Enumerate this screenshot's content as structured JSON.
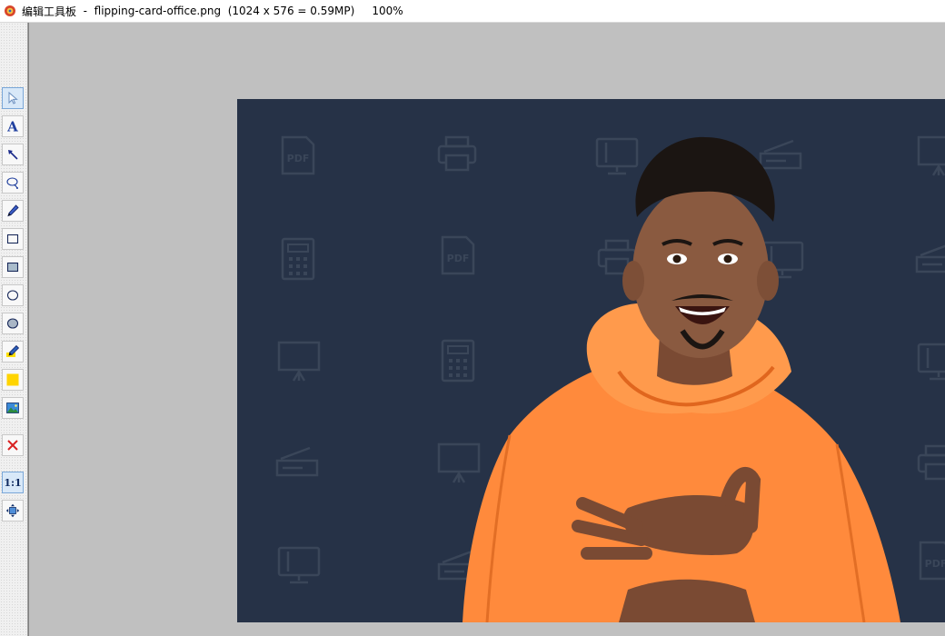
{
  "window": {
    "app_name": "编辑工具板",
    "separator": "-",
    "file_name": "flipping-card-office.png",
    "image_info": "(1024 x 576 = 0.59MP)",
    "zoom": "100%"
  },
  "toolbar": {
    "tools": [
      {
        "name": "select-tool",
        "icon": "cursor-arrow-icon",
        "active": true
      },
      {
        "name": "text-tool",
        "icon": "text-A-icon"
      },
      {
        "name": "arrow-tool",
        "icon": "arrow-icon"
      },
      {
        "name": "lasso-tool",
        "icon": "lasso-icon"
      },
      {
        "name": "pencil-tool",
        "icon": "pencil-icon"
      },
      {
        "name": "rectangle-tool",
        "icon": "rectangle-outline-icon"
      },
      {
        "name": "filled-rectangle-tool",
        "icon": "rectangle-filled-icon"
      },
      {
        "name": "ellipse-tool",
        "icon": "ellipse-outline-icon"
      },
      {
        "name": "filled-ellipse-tool",
        "icon": "ellipse-filled-icon"
      },
      {
        "name": "highlighter-tool",
        "icon": "highlighter-icon"
      },
      {
        "name": "color-picker",
        "icon": "yellow-swatch-icon"
      },
      {
        "name": "insert-image-tool",
        "icon": "image-icon"
      },
      {
        "name": "delete-tool",
        "icon": "red-x-icon"
      },
      {
        "name": "actual-size-button",
        "label": "1:1",
        "active": true
      },
      {
        "name": "fit-window-button",
        "icon": "fit-arrows-icon"
      }
    ]
  },
  "canvas": {
    "image_description_icons": [
      "pdf-icon",
      "printer-icon",
      "monitor-icon",
      "scanner-icon",
      "calculator-icon",
      "presentation-board-icon"
    ],
    "colors": {
      "background": "#263247",
      "icon_stroke": "#3a4659",
      "hoodie": "#ff8a3c"
    }
  }
}
